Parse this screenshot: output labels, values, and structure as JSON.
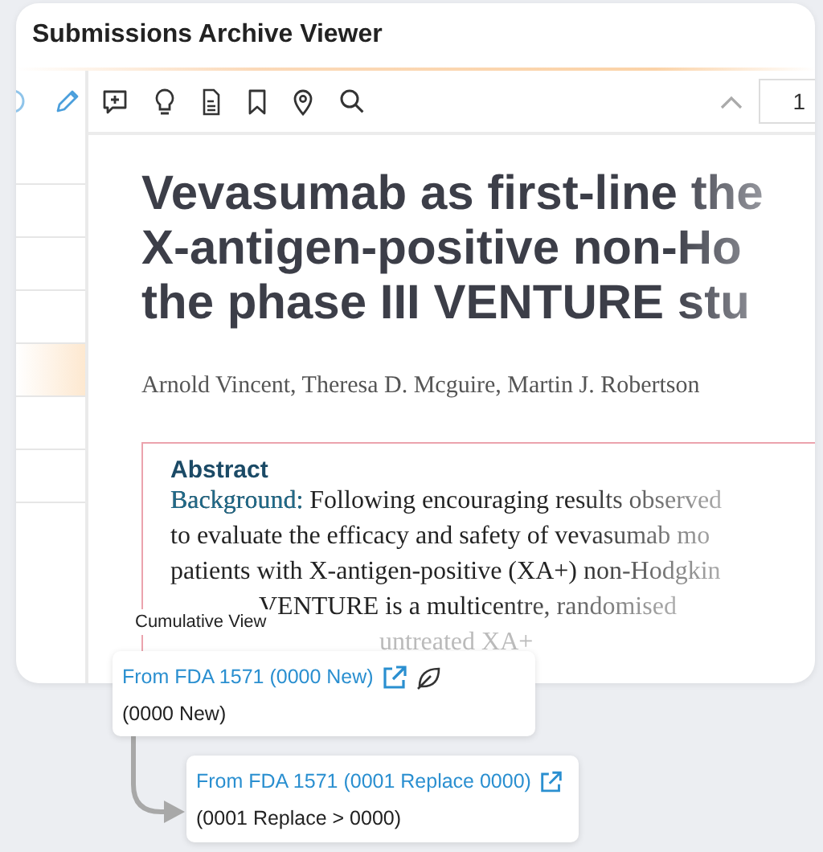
{
  "window": {
    "title": "Submissions Archive Viewer"
  },
  "sidebar": {
    "rows": [
      {
        "selected": false
      },
      {
        "selected": false
      },
      {
        "selected": false
      },
      {
        "selected": false
      },
      {
        "selected": true
      },
      {
        "selected": false
      },
      {
        "selected": false
      }
    ]
  },
  "toolbar": {
    "page": "1"
  },
  "document": {
    "title_lines": [
      "Vevasumab as first-line the",
      "X-antigen-positive non-Ho",
      "the phase III VENTURE stu"
    ],
    "authors": "Arnold Vincent, Theresa D. Mcguire, Martin J. Robertson",
    "abstract": {
      "heading": "Abstract",
      "lines": [
        {
          "label": "Background:",
          "text": "Following encouraging results observed"
        },
        {
          "text": "to evaluate the efficacy and safety of vevasumab mo"
        },
        {
          "text": "patients with X-antigen-positive (XA+) non-Hodgkin"
        },
        {
          "text": "VENTURE is a multicentre, randomised"
        },
        {
          "text": "untreated XA+"
        }
      ]
    }
  },
  "cumulative_view": {
    "label": "Cumulative View",
    "entries": [
      {
        "link": "From FDA 1571 (0000 New)",
        "detail": "(0000 New)",
        "leaf": true
      },
      {
        "link": "From FDA 1571 (0001 Replace 0000)",
        "detail": "(0001 Replace > 0000)",
        "leaf": false
      }
    ]
  }
}
